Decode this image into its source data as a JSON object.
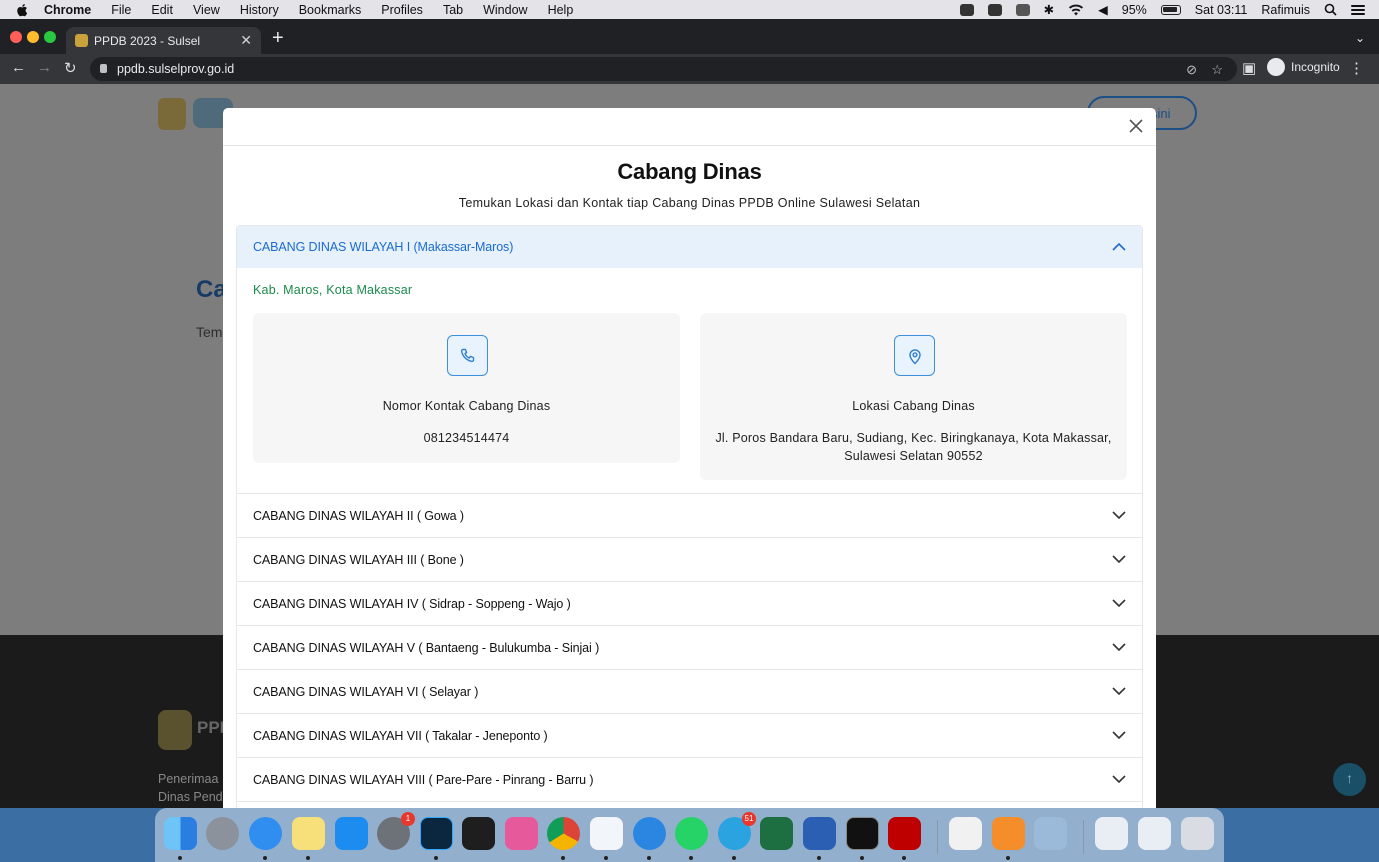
{
  "menubar": {
    "app": "Chrome",
    "items": [
      "File",
      "Edit",
      "View",
      "History",
      "Bookmarks",
      "Profiles",
      "Tab",
      "Window",
      "Help"
    ],
    "battery": "95%",
    "clock": "Sat 03:11",
    "user": "Rafimuis"
  },
  "browser": {
    "tab_title": "PPDB 2023 - Sulsel",
    "url": "ppdb.sulselprov.go.id",
    "profile_label": "Incognito"
  },
  "background_page": {
    "header_button_fragment": "sini",
    "title_fragment": "Ca",
    "subtitle_fragment": "Tem",
    "footer_brand_fragment": "PPI",
    "footer_line1": "Penerimaa",
    "footer_line2": "Dinas Pend"
  },
  "modal": {
    "title": "Cabang Dinas",
    "subtitle": "Temukan Lokasi dan Kontak tiap Cabang Dinas PPDB Online Sulawesi Selatan",
    "open_item": {
      "label": "CABANG DINAS WILAYAH I (Makassar-Maros)",
      "region": "Kab. Maros, Kota Makassar",
      "contact_title": "Nomor Kontak Cabang Dinas",
      "contact_value": "081234514474",
      "location_title": "Lokasi Cabang Dinas",
      "location_value": "Jl. Poros Bandara Baru, Sudiang, Kec. Biringkanaya, Kota Makassar, Sulawesi Selatan 90552"
    },
    "items": [
      "CABANG DINAS WILAYAH II ( Gowa )",
      "CABANG DINAS WILAYAH III ( Bone )",
      "CABANG DINAS WILAYAH IV ( Sidrap - Soppeng - Wajo )",
      "CABANG DINAS WILAYAH V ( Bantaeng - Bulukumba - Sinjai )",
      "CABANG DINAS WILAYAH VI ( Selayar )",
      "CABANG DINAS WILAYAH VII ( Takalar - Jeneponto )",
      "CABANG DINAS WILAYAH VIII ( Pare-Pare - Pinrang - Barru )"
    ]
  },
  "dock": {
    "badges": {
      "system_preferences": "1",
      "telegram": "51"
    },
    "apps": [
      "finder",
      "launchpad",
      "safari",
      "notes",
      "app-store",
      "system-preferences",
      "photoshop",
      "figma",
      "cleanmymac",
      "chrome",
      "vscode",
      "sourcetree",
      "whatsapp",
      "telegram",
      "excel",
      "word",
      "terminal",
      "filezilla",
      "textedit",
      "pages",
      "preview",
      "documents",
      "downloads",
      "trash"
    ]
  }
}
